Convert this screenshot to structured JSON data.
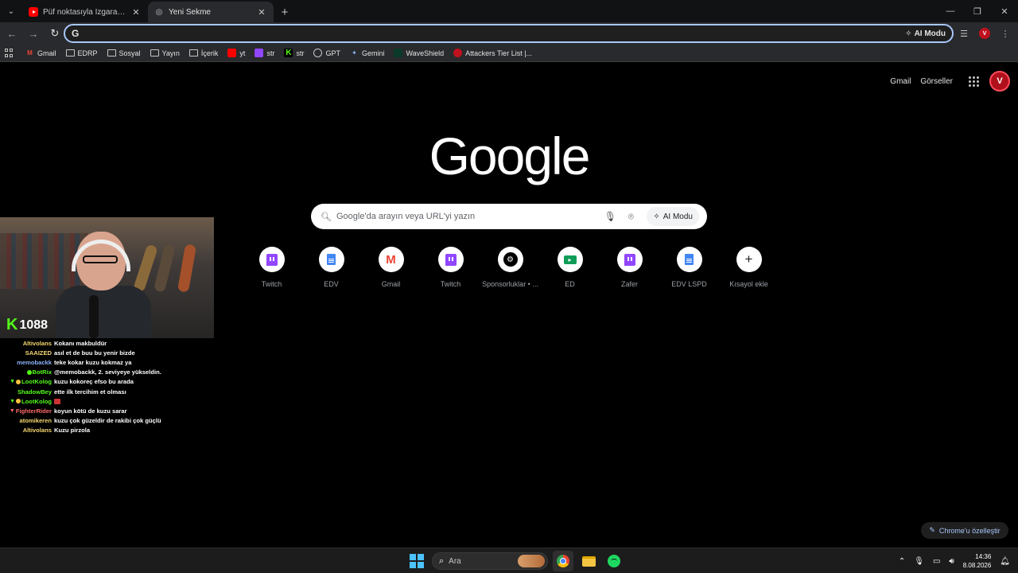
{
  "tabs": [
    {
      "title": "Püf noktasıyla Izgara Bonfile! 🔥",
      "favicon": "youtube-icon"
    },
    {
      "title": "Yeni Sekme",
      "favicon": "new-tab-icon"
    }
  ],
  "omnibox": {
    "value": "",
    "ai_label": "AI Modu"
  },
  "bookmarks": [
    {
      "label": "Gmail",
      "icon": "gmail"
    },
    {
      "label": "EDRP",
      "icon": "folder"
    },
    {
      "label": "Sosyal",
      "icon": "folder"
    },
    {
      "label": "Yayın",
      "icon": "folder"
    },
    {
      "label": "İçerik",
      "icon": "folder"
    },
    {
      "label": "yt",
      "icon": "youtube"
    },
    {
      "label": "str",
      "icon": "twitch"
    },
    {
      "label": "str",
      "icon": "kick"
    },
    {
      "label": "GPT",
      "icon": "gpt"
    },
    {
      "label": "Gemini",
      "icon": "gemini"
    },
    {
      "label": "WaveShield",
      "icon": "waveshield"
    },
    {
      "label": "Attackers Tier List |...",
      "icon": "attackers"
    }
  ],
  "header": {
    "gmail": "Gmail",
    "images": "Görseller",
    "avatar_letter": "V"
  },
  "logo": "Google",
  "search": {
    "placeholder": "Google'da arayın veya URL'yi yazın",
    "ai_label": "AI Modu"
  },
  "shortcuts": [
    {
      "label": "Twitch",
      "icon": "twitch"
    },
    {
      "label": "EDV",
      "icon": "docs"
    },
    {
      "label": "Gmail",
      "icon": "gmail"
    },
    {
      "label": "Twitch",
      "icon": "twitch"
    },
    {
      "label": "Sponsorluklar • ...",
      "icon": "sponsor"
    },
    {
      "label": "ED",
      "icon": "ed"
    },
    {
      "label": "Zafer",
      "icon": "twitch"
    },
    {
      "label": "EDV LSPD",
      "icon": "docs"
    },
    {
      "label": "Kısayol ekle",
      "icon": "plus"
    }
  ],
  "stream": {
    "viewer_count": "1088",
    "chat": [
      {
        "user": "Altivolans",
        "color": "#f5d76e",
        "badges": "",
        "text": "Kokanı makbuldür"
      },
      {
        "user": "SAAIZED",
        "color": "#f5d76e",
        "badges": "",
        "text": "asıl et de buu bu yenir bizde"
      },
      {
        "user": "memobackk",
        "color": "#8ab4f8",
        "badges": "",
        "text": "teke kokar kuzu kokmaz ya"
      },
      {
        "user": "BotRix",
        "color": "#53fc18",
        "badges": "bot",
        "text": "@memobackk, 2. seviyeye yükseldin."
      },
      {
        "user": "LootKolog",
        "color": "#53fc18",
        "badges": "vip",
        "text": "kuzu kokoreç efso bu arada"
      },
      {
        "user": "ShadowBey",
        "color": "#53fc18",
        "badges": "",
        "text": "ette ilk tercihim et olması"
      },
      {
        "user": "LootKolog",
        "color": "#53fc18",
        "badges": "vip",
        "text": ""
      },
      {
        "user": "FighterRider",
        "color": "#ff6b6b",
        "badges": "mod",
        "text": "koyun kötü de kuzu sarar"
      },
      {
        "user": "atomikeren",
        "color": "#f5d76e",
        "badges": "",
        "text": "kuzu çok güzeldir de rakibi çok güçlü"
      },
      {
        "user": "Altivolans",
        "color": "#f5d76e",
        "badges": "",
        "text": "Kuzu pirzola"
      }
    ]
  },
  "customize_label": "Chrome'u özelleştir",
  "taskbar": {
    "search_placeholder": "Ara",
    "time": "14:36",
    "date": "8.08.2026"
  }
}
